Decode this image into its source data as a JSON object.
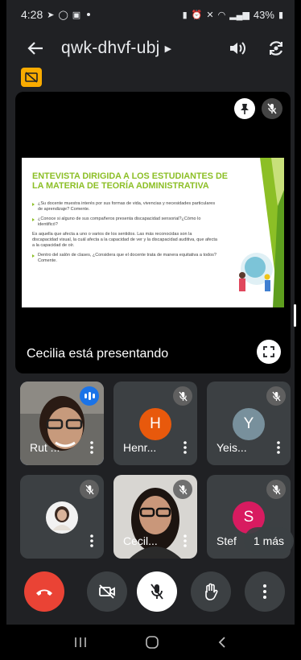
{
  "status_bar": {
    "time": "4:28",
    "battery": "43%"
  },
  "header": {
    "meeting_code": "qwk-dhvf-ubj"
  },
  "presentation": {
    "slide_title": "ENTEVISTA DIRIGIDA A LOS ESTUDIANTES DE LA MATERIA DE TEORÍA ADMINISTRATIVA",
    "slide_points": [
      "¿Su docente muestra interés por sus formas de vida, vivencias y necesidades particulares de aprendizaje? Comente.",
      "¿Conoce si alguno de sus compañeros presenta discapacidad sensorial?¿Cómo lo identificó?",
      "Es aquella que afecta a uno o varios de los sentidos. Las más reconocidas son la discapacidad visual, la cuál afecta a la capacidad de ver y la discapacidad auditiva, que afecta a la capacidad de oír.",
      "Dentro del salón de clases, ¿Considera que el docente trata de manera equitativa a todos? Comente."
    ],
    "presenting_label": "Cecilia está presentando"
  },
  "participants": [
    {
      "name": "Rut ...",
      "initial": "",
      "type": "video",
      "speaking": true
    },
    {
      "name": "Henr...",
      "initial": "H",
      "color": "#e8590c",
      "type": "avatar"
    },
    {
      "name": "Yeis...",
      "initial": "Y",
      "color": "#78909c",
      "type": "avatar"
    },
    {
      "name": "",
      "initial": "",
      "type": "photo"
    },
    {
      "name": "Cecil...",
      "initial": "",
      "type": "video"
    },
    {
      "name": "Stef",
      "initial": "S",
      "color": "#d81b60",
      "type": "avatar"
    }
  ],
  "more_participants": "1 más",
  "colors": {
    "end_call": "#ea4335",
    "control_bg": "#3c4043",
    "badge": "#f9ab00",
    "accent": "#8cbf26"
  }
}
